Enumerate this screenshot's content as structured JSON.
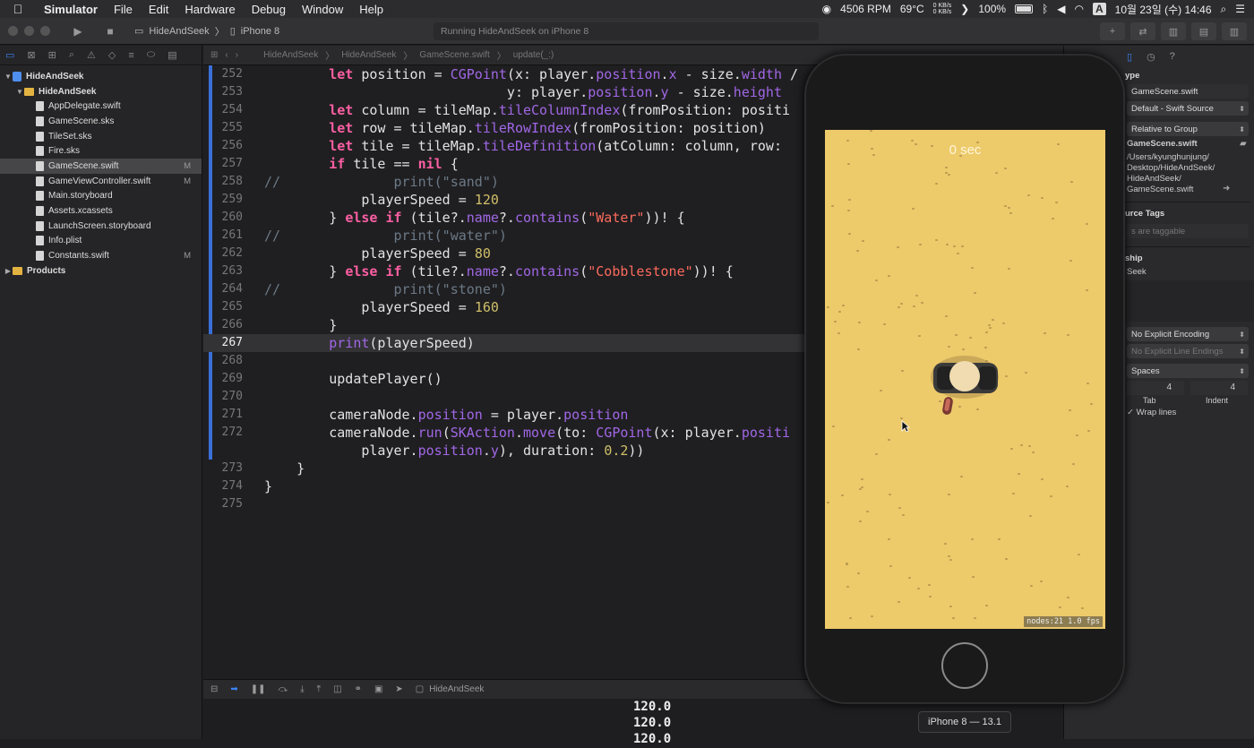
{
  "menubar": {
    "app": "Simulator",
    "items": [
      "File",
      "Edit",
      "Hardware",
      "Debug",
      "Window",
      "Help"
    ],
    "rpm": "4506 RPM",
    "temp": "69°C",
    "net_up": "0 KB/s",
    "net_down": "0 KB/s",
    "battery": "100%",
    "input": "A",
    "datetime": "10월 23일 (수) 14:46"
  },
  "toolbar": {
    "scheme": "HideAndSeek",
    "device": "iPhone 8",
    "status": "Running HideAndSeek on iPhone 8"
  },
  "navigator": {
    "items": [
      {
        "label": "HideAndSeek",
        "kind": "project",
        "indent": 0,
        "disc": "▼"
      },
      {
        "label": "HideAndSeek",
        "kind": "folder",
        "indent": 1,
        "disc": "▼"
      },
      {
        "label": "AppDelegate.swift",
        "kind": "file",
        "indent": 2
      },
      {
        "label": "GameScene.sks",
        "kind": "file",
        "indent": 2
      },
      {
        "label": "TileSet.sks",
        "kind": "file",
        "indent": 2
      },
      {
        "label": "Fire.sks",
        "kind": "file",
        "indent": 2
      },
      {
        "label": "GameScene.swift",
        "kind": "file",
        "indent": 2,
        "badge": "M",
        "selected": true
      },
      {
        "label": "GameViewController.swift",
        "kind": "file",
        "indent": 2,
        "badge": "M"
      },
      {
        "label": "Main.storyboard",
        "kind": "file",
        "indent": 2
      },
      {
        "label": "Assets.xcassets",
        "kind": "file",
        "indent": 2
      },
      {
        "label": "LaunchScreen.storyboard",
        "kind": "file",
        "indent": 2
      },
      {
        "label": "Info.plist",
        "kind": "file",
        "indent": 2
      },
      {
        "label": "Constants.swift",
        "kind": "file",
        "indent": 2,
        "badge": "M"
      },
      {
        "label": "Products",
        "kind": "folder",
        "indent": 0,
        "disc": "▶"
      }
    ]
  },
  "jumpbar": {
    "crumbs": [
      "HideAndSeek",
      "HideAndSeek",
      "GameScene.swift",
      "update(_:)"
    ]
  },
  "editor": {
    "highlight_line": "267",
    "lines": [
      {
        "n": "252",
        "html": "        <span class=\"kw\">let</span> position = <span class=\"fn\">CGPoint</span>(x: player.<span class=\"pr\">position</span>.<span class=\"pr\">x</span> - size.<span class=\"pr\">width</span> /"
      },
      {
        "n": "253",
        "html": "                              y: player.<span class=\"pr\">position</span>.<span class=\"pr\">y</span> - size.<span class=\"pr\">height</span>"
      },
      {
        "n": "254",
        "html": "        <span class=\"kw\">let</span> column = tileMap.<span class=\"fn\">tileColumnIndex</span>(fromPosition: positi"
      },
      {
        "n": "255",
        "html": "        <span class=\"kw\">let</span> row = tileMap.<span class=\"fn\">tileRowIndex</span>(fromPosition: position)"
      },
      {
        "n": "256",
        "html": "        <span class=\"kw\">let</span> tile = tileMap.<span class=\"fn\">tileDefinition</span>(atColumn: column, row:"
      },
      {
        "n": "257",
        "html": "        <span class=\"kw\">if</span> tile == <span class=\"kw\">nil</span> {"
      },
      {
        "n": "258",
        "html": "<span class=\"cm\">//              print(\"sand\")</span>"
      },
      {
        "n": "259",
        "html": "            playerSpeed = <span class=\"num\">120</span>"
      },
      {
        "n": "260",
        "html": "        } <span class=\"kw\">else if</span> (tile?.<span class=\"pr\">name</span>?.<span class=\"fn\">contains</span>(<span class=\"str\">\"Water\"</span>))! {"
      },
      {
        "n": "261",
        "html": "<span class=\"cm\">//              print(\"water\")</span>"
      },
      {
        "n": "262",
        "html": "            playerSpeed = <span class=\"num\">80</span>"
      },
      {
        "n": "263",
        "html": "        } <span class=\"kw\">else if</span> (tile?.<span class=\"pr\">name</span>?.<span class=\"fn\">contains</span>(<span class=\"str\">\"Cobblestone\"</span>))! {"
      },
      {
        "n": "264",
        "html": "<span class=\"cm\">//              print(\"stone\")</span>"
      },
      {
        "n": "265",
        "html": "            playerSpeed = <span class=\"num\">160</span>"
      },
      {
        "n": "266",
        "html": "        }"
      },
      {
        "n": "267",
        "html": "        <span class=\"fn\">print</span>(playerSpeed)"
      },
      {
        "n": "268",
        "html": ""
      },
      {
        "n": "269",
        "html": "        updatePlayer()"
      },
      {
        "n": "270",
        "html": ""
      },
      {
        "n": "271",
        "html": "        cameraNode.<span class=\"pr\">position</span> = player.<span class=\"pr\">position</span>"
      },
      {
        "n": "272",
        "html": "        cameraNode.<span class=\"fn\">run</span>(<span class=\"fn\">SKAction</span>.<span class=\"fn\">move</span>(to: <span class=\"fn\">CGPoint</span>(x: player.<span class=\"pr\">positi</span>"
      },
      {
        "n": "",
        "html": "            player.<span class=\"pr\">position</span>.<span class=\"pr\">y</span>), duration: <span class=\"num\">0.2</span>))"
      },
      {
        "n": "273",
        "html": "    }"
      },
      {
        "n": "274",
        "html": "}"
      },
      {
        "n": "275",
        "html": ""
      }
    ]
  },
  "debugbar": {
    "target": "HideAndSeek"
  },
  "console": {
    "lines": [
      "120.0",
      "120.0",
      "120.0"
    ]
  },
  "inspector": {
    "type_title": "ype",
    "name_value": "GameScene.swift",
    "file_type": "Default - Swift Source",
    "location": "Relative to Group",
    "location_file": "GameScene.swift",
    "full_path": [
      "/Users/kyunghunjung/",
      "Desktop/HideAndSeek/",
      "HideAndSeek/",
      "GameScene.swift"
    ],
    "tags_title": "urce Tags",
    "tags_placeholder": "s are taggable",
    "membership_title": "ship",
    "membership_item": "Seek",
    "encoding": "No Explicit Encoding",
    "line_endings": "No Explicit Line Endings",
    "indent_using": "Spaces",
    "tab_value": "4",
    "indent_value": "4",
    "tab_label": "Tab",
    "indent_label": "Indent",
    "wrap_lines": "Wrap lines"
  },
  "simulator": {
    "timer": "0 sec",
    "stats": "nodes:21  1.0 fps",
    "device_label": "iPhone 8 — 13.1",
    "sand_color": "#edca6a"
  }
}
